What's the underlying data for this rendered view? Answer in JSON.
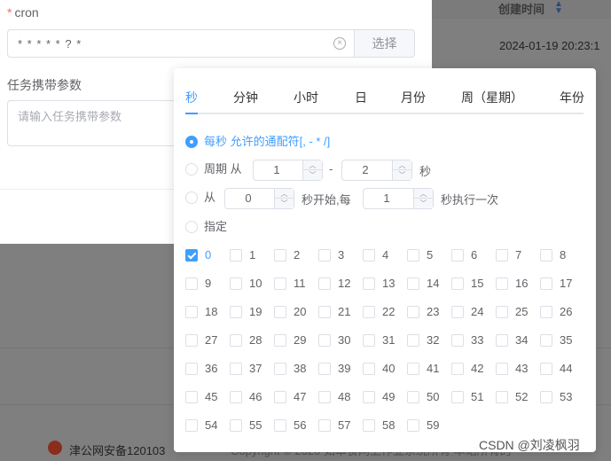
{
  "background": {
    "table_header": "创建时间",
    "row_datetime": "2024-01-19 20:23:1",
    "footer_beian": "津公网安备120103",
    "footer_copy": "Copyright © 2020 如皋食网上作业系统所有 本站所有的"
  },
  "dialog": {
    "cron_label": "cron",
    "cron_value": "* * * * * ? *",
    "choose_button": "选择",
    "param_label": "任务携带参数",
    "param_placeholder": "请输入任务携带参数"
  },
  "popover": {
    "tabs": [
      "秒",
      "分钟",
      "小时",
      "日",
      "月份",
      "周（星期）",
      "年份"
    ],
    "active_tab": "秒",
    "options": {
      "every": "每秒 允许的通配符[, - * /]",
      "cycle_prefix": "周期 从",
      "cycle_from": "1",
      "cycle_dash": "-",
      "cycle_to": "2",
      "cycle_suffix": "秒",
      "from_prefix": "从",
      "from_start": "0",
      "from_mid": "秒开始,每",
      "from_step": "1",
      "from_suffix": "秒执行一次",
      "specify": "指定"
    },
    "seconds": [
      "0",
      "1",
      "2",
      "3",
      "4",
      "5",
      "6",
      "7",
      "8",
      "9",
      "10",
      "11",
      "12",
      "13",
      "14",
      "15",
      "16",
      "17",
      "18",
      "19",
      "20",
      "21",
      "22",
      "23",
      "24",
      "25",
      "26",
      "27",
      "28",
      "29",
      "30",
      "31",
      "32",
      "33",
      "34",
      "35",
      "36",
      "37",
      "38",
      "39",
      "40",
      "41",
      "42",
      "43",
      "44",
      "45",
      "46",
      "47",
      "48",
      "49",
      "50",
      "51",
      "52",
      "53",
      "54",
      "55",
      "56",
      "57",
      "58",
      "59"
    ],
    "checked_seconds": [
      "0"
    ]
  },
  "watermark": "CSDN @刘凌枫羽",
  "colors": {
    "accent": "#409eff",
    "required": "#f56c6c"
  }
}
